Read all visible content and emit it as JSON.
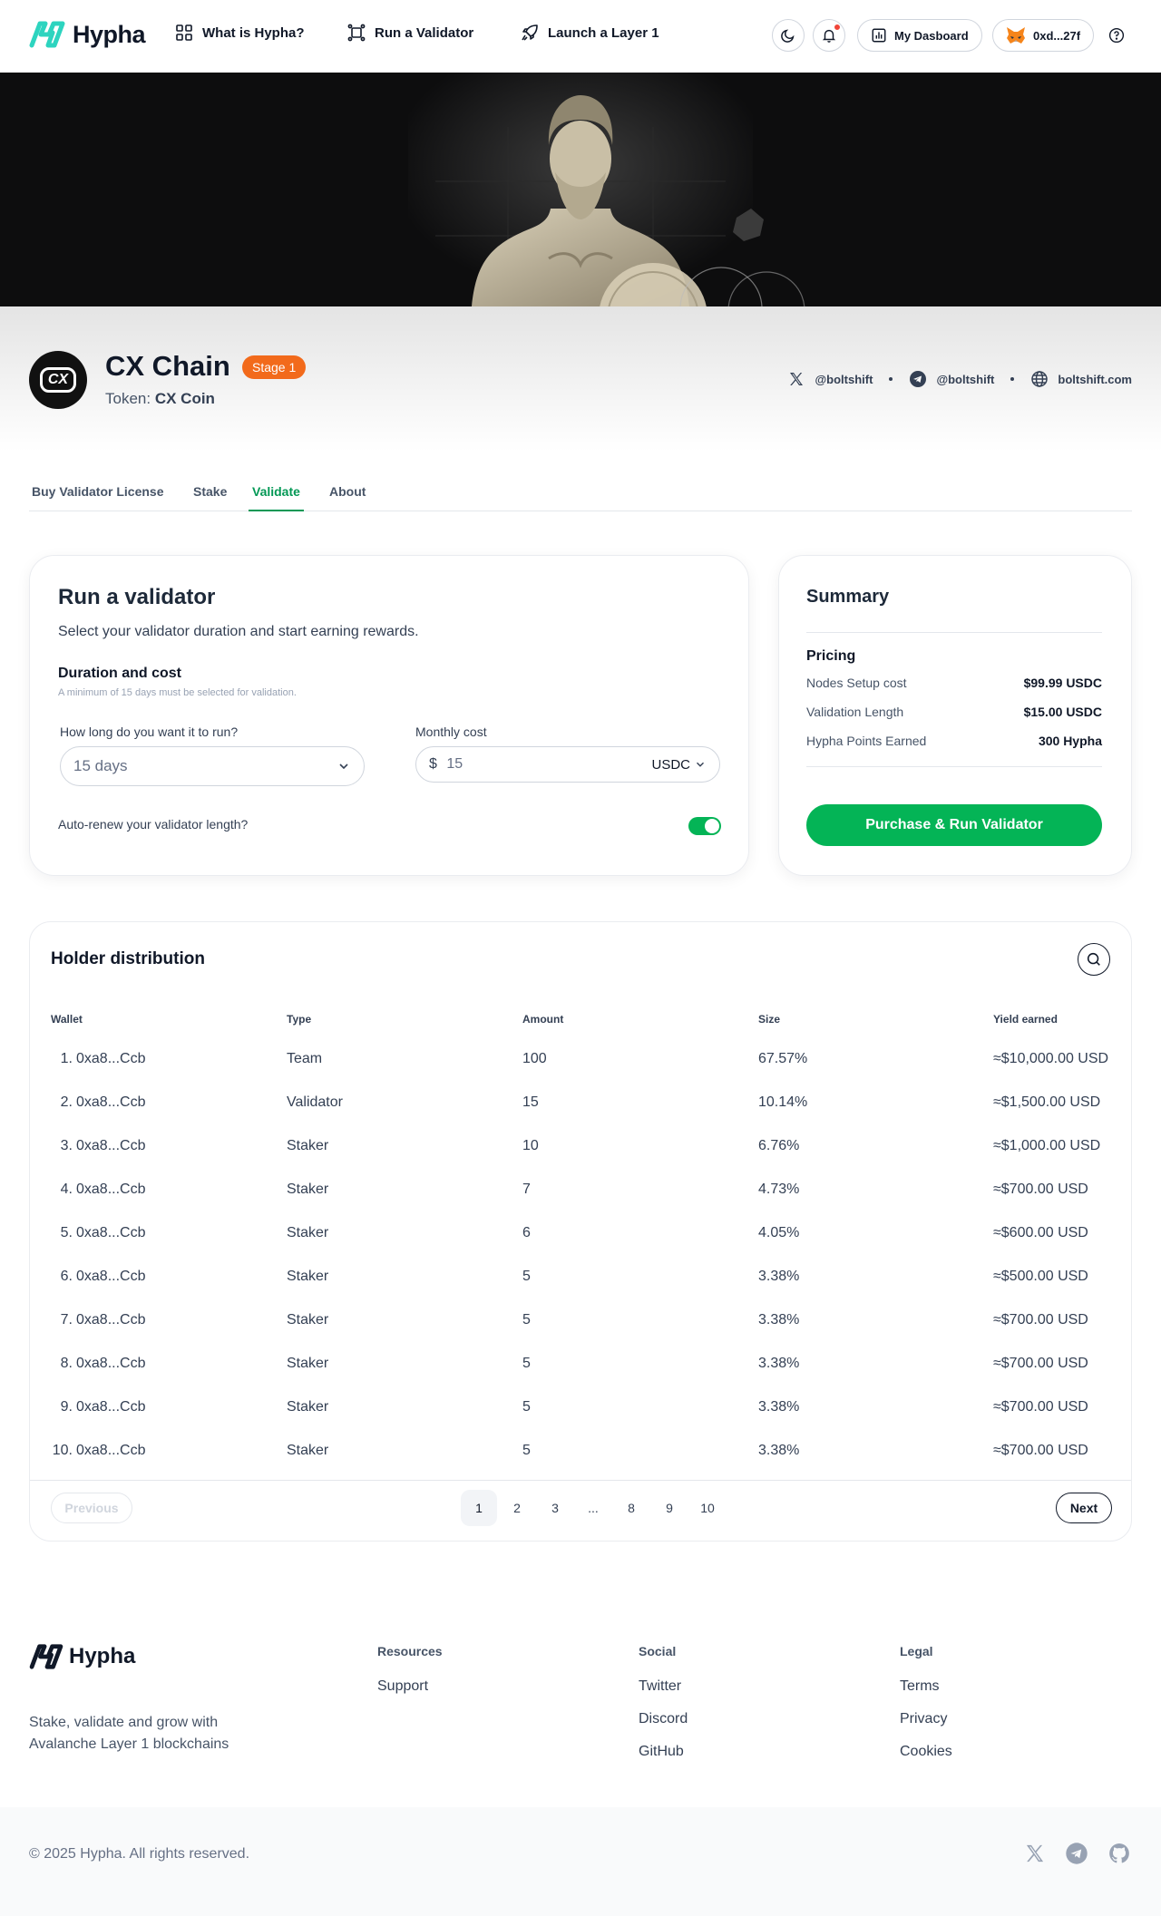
{
  "brand": {
    "name": "Hypha",
    "accent": "#04b456",
    "logo_color": "#2dd4bf"
  },
  "nav": {
    "links": [
      "What is Hypha?",
      "Run a Validator",
      "Launch a Layer 1"
    ],
    "dashboard_label": "My Dasboard",
    "wallet_label": "0xd...27f"
  },
  "chain": {
    "logo_text": "CX",
    "name": "CX Chain",
    "stage": "Stage 1",
    "token_prefix": "Token:",
    "token_name": "CX Coin",
    "twitter": "@boltshift",
    "telegram": "@boltshift",
    "website": "boltshift.com"
  },
  "tabs": [
    "Buy Validator License",
    "Stake",
    "Validate",
    "About"
  ],
  "validator": {
    "title": "Run a validator",
    "subtitle": "Select your validator duration and start earning rewards.",
    "section_title": "Duration and cost",
    "section_hint": "A minimum of 15 days must be selected for validation.",
    "duration_label": "How long do you want it to run?",
    "duration_value": "15 days",
    "monthly_label": "Monthly cost",
    "currency_symbol": "$",
    "monthly_value": "15",
    "currency": "USDC",
    "autorenew_label": "Auto-renew your validator length?",
    "autorenew_on": true
  },
  "summary": {
    "title": "Summary",
    "pricing_label": "Pricing",
    "rows": [
      {
        "label": "Nodes Setup cost",
        "value": "$99.99 USDC"
      },
      {
        "label": "Validation Length",
        "value": "$15.00 USDC"
      },
      {
        "label": "Hypha Points Earned",
        "value": "300 Hypha"
      }
    ],
    "cta": "Purchase & Run Validator"
  },
  "holders": {
    "title": "Holder distribution",
    "columns": [
      "Wallet",
      "Type",
      "Amount",
      "Size",
      "Yield earned"
    ],
    "rows": [
      [
        "1.",
        "0xa8...Ccb",
        "Team",
        "100",
        "67.57%",
        "≈$10,000.00 USD"
      ],
      [
        "2.",
        "0xa8...Ccb",
        "Validator",
        "15",
        "10.14%",
        "≈$1,500.00 USD"
      ],
      [
        "3.",
        "0xa8...Ccb",
        "Staker",
        "10",
        "6.76%",
        "≈$1,000.00 USD"
      ],
      [
        "4.",
        "0xa8...Ccb",
        "Staker",
        "7",
        "4.73%",
        "≈$700.00 USD"
      ],
      [
        "5.",
        "0xa8...Ccb",
        "Staker",
        "6",
        "4.05%",
        "≈$600.00 USD"
      ],
      [
        "6.",
        "0xa8...Ccb",
        "Staker",
        "5",
        "3.38%",
        "≈$500.00 USD"
      ],
      [
        "7.",
        "0xa8...Ccb",
        "Staker",
        "5",
        "3.38%",
        "≈$700.00 USD"
      ],
      [
        "8.",
        "0xa8...Ccb",
        "Staker",
        "5",
        "3.38%",
        "≈$700.00 USD"
      ],
      [
        "9.",
        "0xa8...Ccb",
        "Staker",
        "5",
        "3.38%",
        "≈$700.00 USD"
      ],
      [
        "10.",
        "0xa8...Ccb",
        "Staker",
        "5",
        "3.38%",
        "≈$700.00 USD"
      ]
    ],
    "pagination": {
      "previous": "Previous",
      "next": "Next",
      "pages": [
        "1",
        "2",
        "3",
        "...",
        "8",
        "9",
        "10"
      ],
      "current": "1"
    }
  },
  "footer": {
    "tagline_1": "Stake, validate and grow with",
    "tagline_2": "Avalanche Layer 1 blockchains",
    "columns": [
      {
        "title": "Resources",
        "links": [
          "Support"
        ]
      },
      {
        "title": "Social",
        "links": [
          "Twitter",
          "Discord",
          "GitHub"
        ]
      },
      {
        "title": "Legal",
        "links": [
          "Terms",
          "Privacy",
          "Cookies"
        ]
      }
    ],
    "copyright": "© 2025 Hypha. All rights reserved."
  }
}
